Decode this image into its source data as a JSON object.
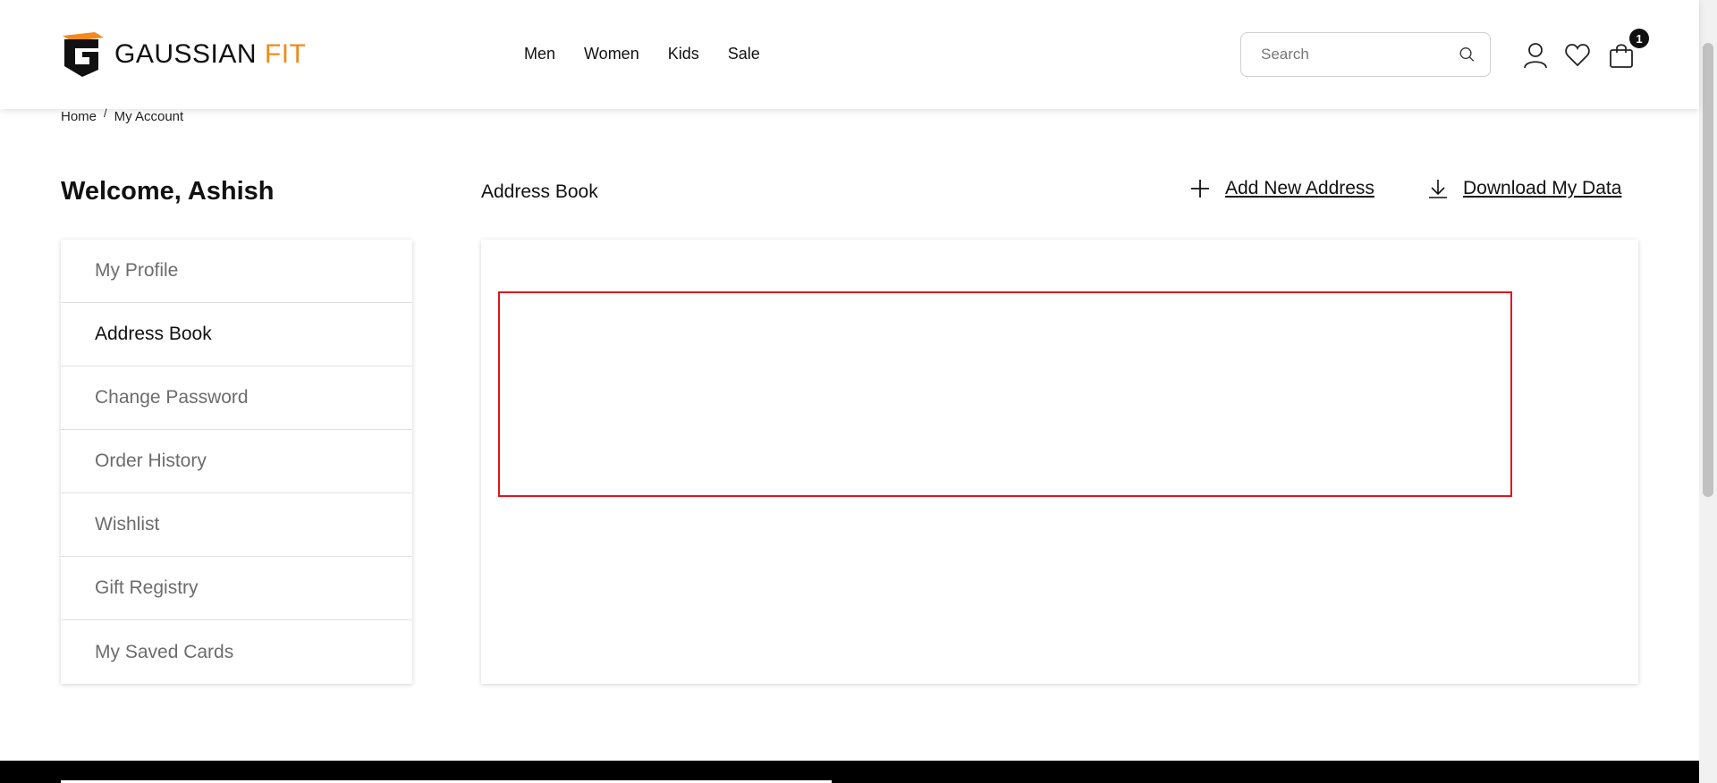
{
  "brand": {
    "name": "GAUSSIAN",
    "suffix": "FIT",
    "accent_color": "#f08a1c"
  },
  "nav": {
    "items": [
      "Men",
      "Women",
      "Kids",
      "Sale"
    ]
  },
  "search": {
    "placeholder": "Search"
  },
  "header_icons": {
    "account": "user-icon",
    "wishlist": "heart-icon",
    "cart": "cart-icon",
    "cart_count": "1"
  },
  "breadcrumb": {
    "home": "Home",
    "separator": "/",
    "current": "My Account"
  },
  "welcome": "Welcome, Ashish",
  "sidebar": {
    "active": "Address Book",
    "items": [
      {
        "label": "My Profile"
      },
      {
        "label": "Address Book"
      },
      {
        "label": "Change Password"
      },
      {
        "label": "Order History"
      },
      {
        "label": "Wishlist"
      },
      {
        "label": "Gift Registry"
      },
      {
        "label": "My Saved Cards"
      }
    ]
  },
  "content": {
    "title": "Address Book",
    "add_address": "Add New Address",
    "download_data": "Download My Data"
  },
  "colors": {
    "highlight": "#e0151d",
    "footer": "#000000"
  }
}
